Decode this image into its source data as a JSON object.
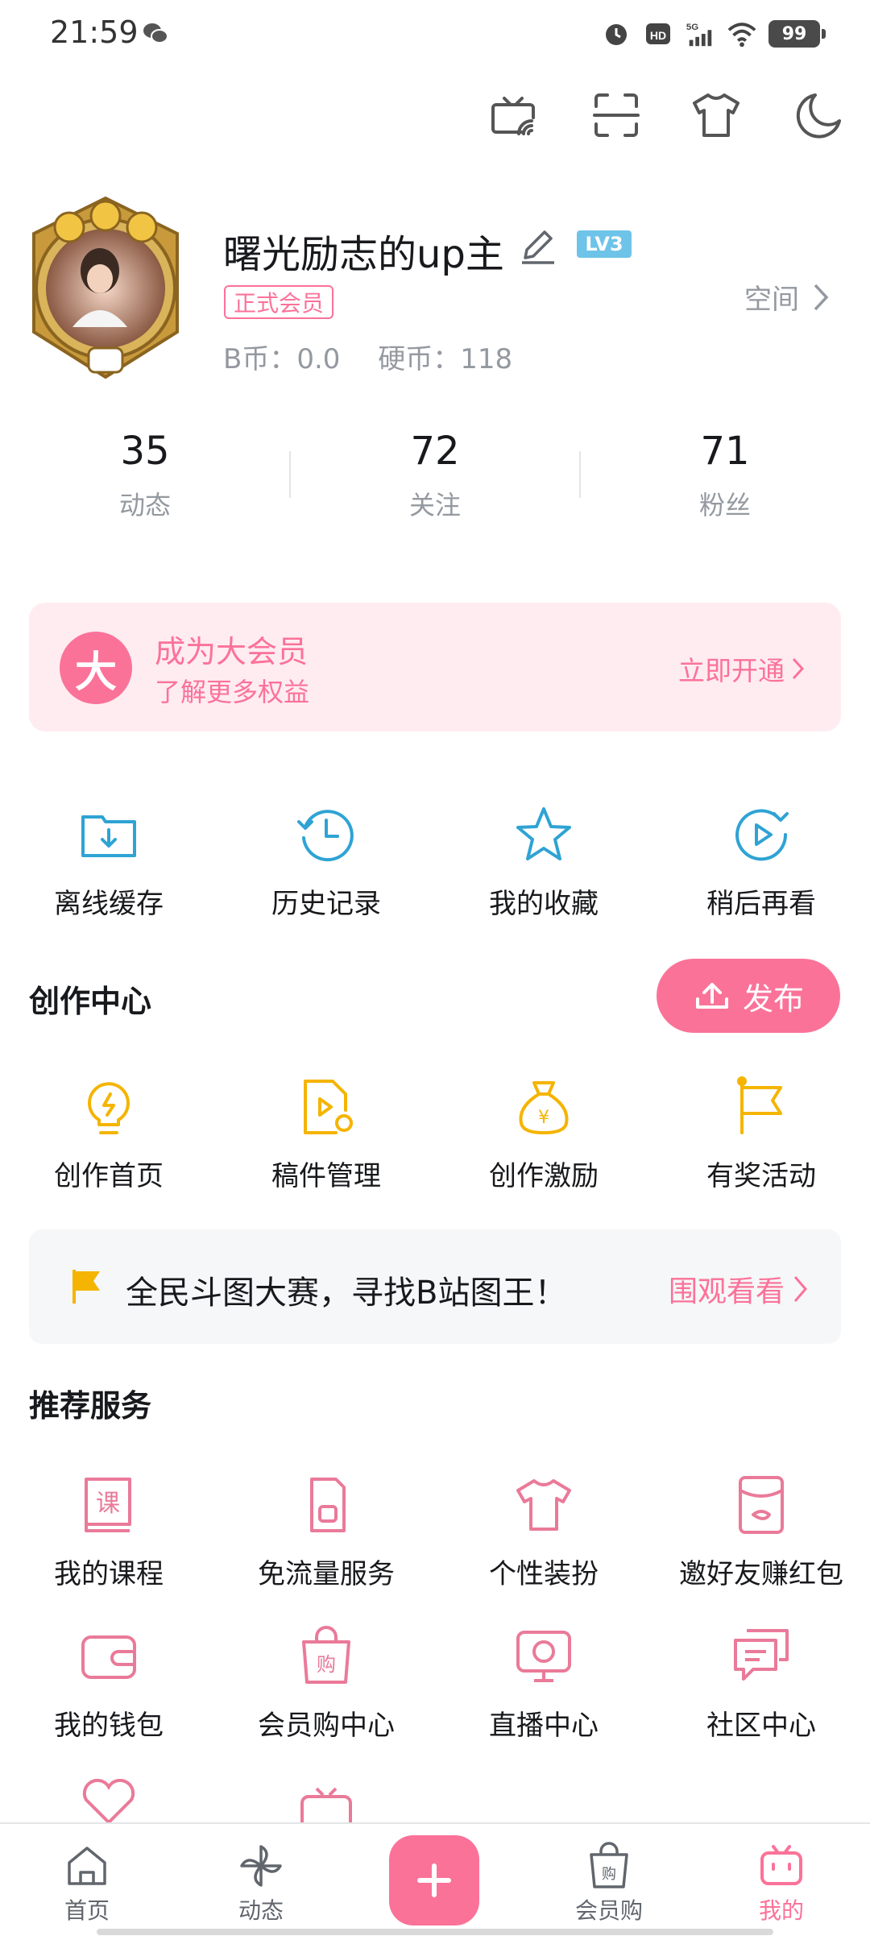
{
  "status_bar": {
    "time": "21:59",
    "battery": "99",
    "icons": [
      "alarm-icon",
      "hd-icon",
      "5g-signal-icon",
      "wifi-icon",
      "battery-icon"
    ]
  },
  "top_actions": [
    "tv-cast-icon",
    "scan-icon",
    "outfit-icon",
    "night-mode-icon"
  ],
  "profile": {
    "username": "曙光励志的up主",
    "level": "LV3",
    "member_tag": "正式会员",
    "space_label": "空间",
    "b_coin": "B币：0.0",
    "coins": "硬币：118"
  },
  "stats": [
    {
      "value": "35",
      "label": "动态"
    },
    {
      "value": "72",
      "label": "关注"
    },
    {
      "value": "71",
      "label": "粉丝"
    }
  ],
  "vip_banner": {
    "logo": "大",
    "title": "成为大会员",
    "subtitle": "了解更多权益",
    "action": "立即开通"
  },
  "quick_actions": [
    {
      "label": "离线缓存",
      "icon": "download-folder-icon"
    },
    {
      "label": "历史记录",
      "icon": "history-clock-icon"
    },
    {
      "label": "我的收藏",
      "icon": "star-icon"
    },
    {
      "label": "稍后再看",
      "icon": "watch-later-icon"
    }
  ],
  "creation": {
    "title": "创作中心",
    "publish_label": "发布",
    "items": [
      {
        "label": "创作首页",
        "icon": "lightbulb-icon"
      },
      {
        "label": "稿件管理",
        "icon": "manuscript-icon"
      },
      {
        "label": "创作激励",
        "icon": "money-bag-icon"
      },
      {
        "label": "有奖活动",
        "icon": "flag-icon"
      }
    ]
  },
  "promo": {
    "text": "全民斗图大赛，寻找B站图王！",
    "action": "围观看看"
  },
  "services": {
    "title": "推荐服务",
    "items": [
      {
        "label": "我的课程",
        "icon": "course-icon"
      },
      {
        "label": "免流量服务",
        "icon": "sim-card-icon"
      },
      {
        "label": "个性装扮",
        "icon": "tshirt-icon"
      },
      {
        "label": "邀好友赚红包",
        "icon": "red-packet-icon"
      },
      {
        "label": "我的钱包",
        "icon": "wallet-icon"
      },
      {
        "label": "会员购中心",
        "icon": "shopping-bag-icon"
      },
      {
        "label": "直播中心",
        "icon": "live-tv-icon"
      },
      {
        "label": "社区中心",
        "icon": "chat-bubble-icon"
      }
    ]
  },
  "bottom_nav": [
    {
      "label": "首页",
      "icon": "home-icon"
    },
    {
      "label": "动态",
      "icon": "pinwheel-icon"
    },
    {
      "label": "",
      "icon": "plus-icon"
    },
    {
      "label": "会员购",
      "icon": "shopping-bag-icon"
    },
    {
      "label": "我的",
      "icon": "tv-icon"
    }
  ],
  "colors": {
    "pink": "#fb7299",
    "blue": "#2fa3d4",
    "gold": "#f5b400",
    "gray_text": "#9499a0"
  }
}
